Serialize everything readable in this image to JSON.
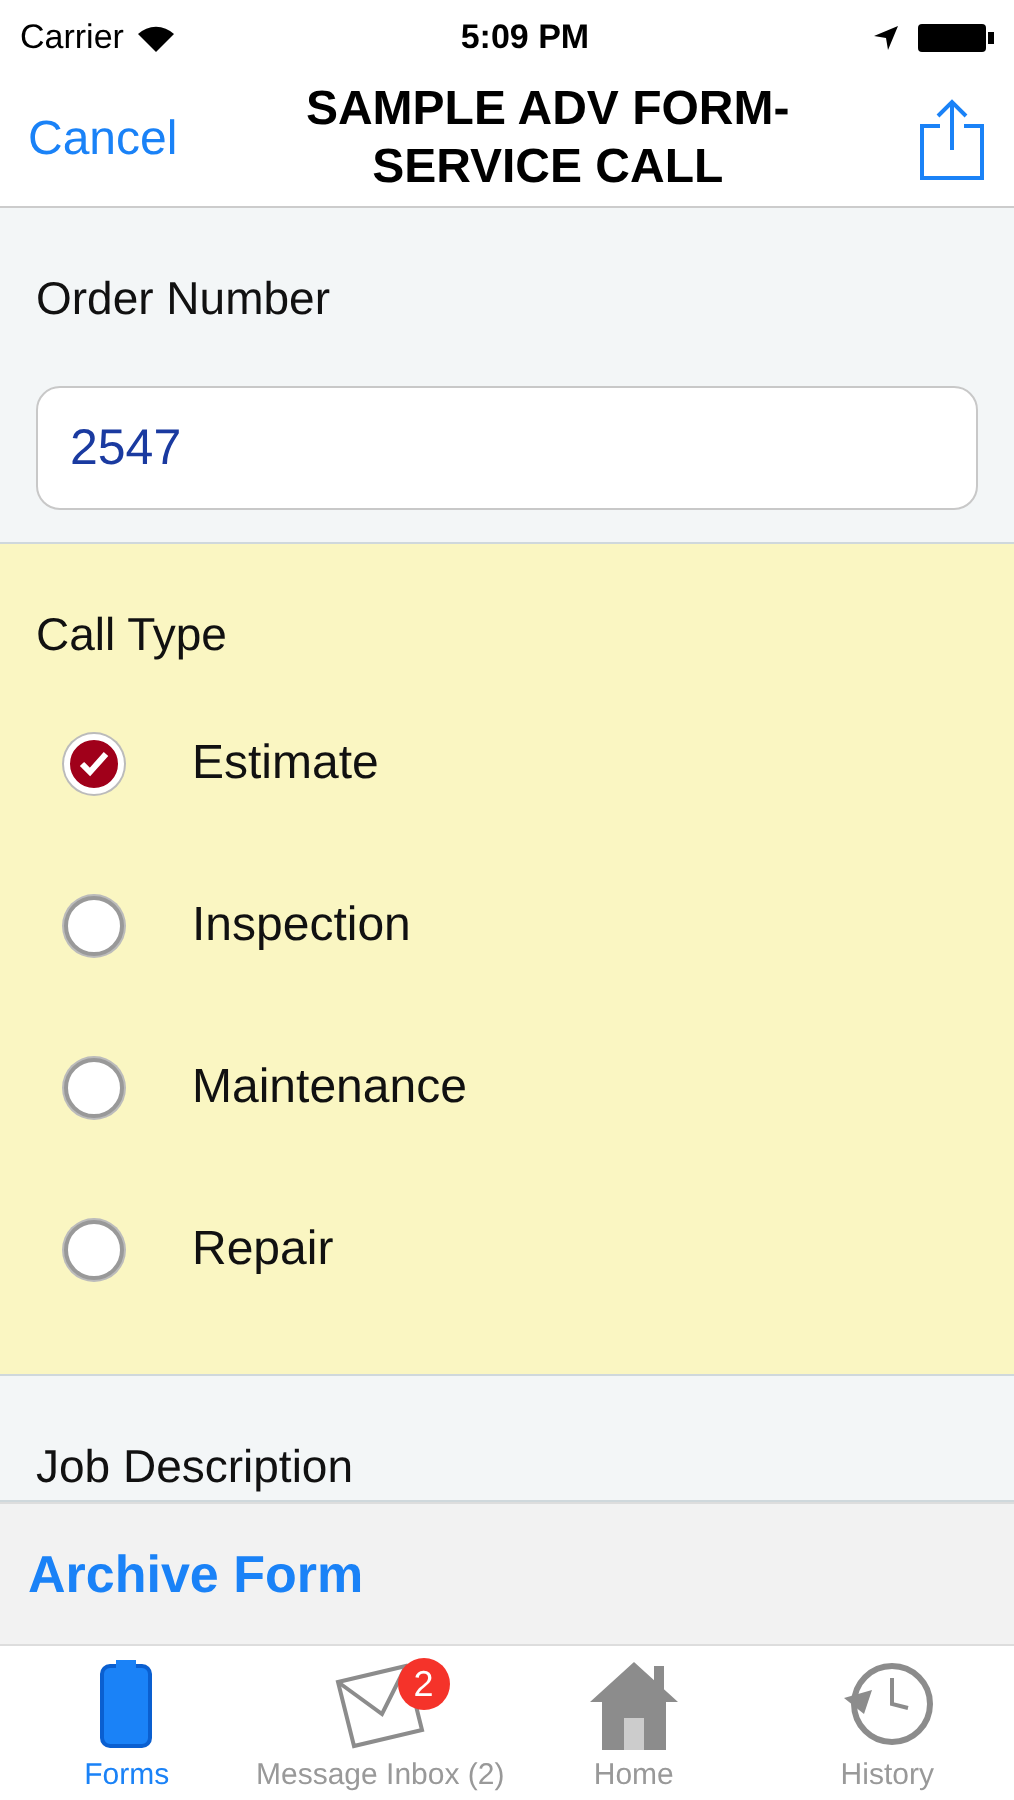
{
  "status_bar": {
    "carrier": "Carrier",
    "time": "5:09 PM"
  },
  "nav": {
    "cancel": "Cancel",
    "title": "SAMPLE ADV FORM-\nSERVICE CALL"
  },
  "order": {
    "label": "Order Number",
    "value": "2547"
  },
  "call_type": {
    "label": "Call Type",
    "options": [
      {
        "label": "Estimate",
        "selected": true
      },
      {
        "label": "Inspection",
        "selected": false
      },
      {
        "label": "Maintenance",
        "selected": false
      },
      {
        "label": "Repair",
        "selected": false
      }
    ]
  },
  "job_description": {
    "label": "Job Description"
  },
  "archive": "Archive Form",
  "tabs": [
    {
      "kind": "forms",
      "label": "Forms",
      "selected": true
    },
    {
      "kind": "inbox",
      "label": "Message Inbox (2)",
      "selected": false,
      "badge": "2"
    },
    {
      "kind": "home",
      "label": "Home",
      "selected": false
    },
    {
      "kind": "history",
      "label": "History",
      "selected": false
    }
  ]
}
